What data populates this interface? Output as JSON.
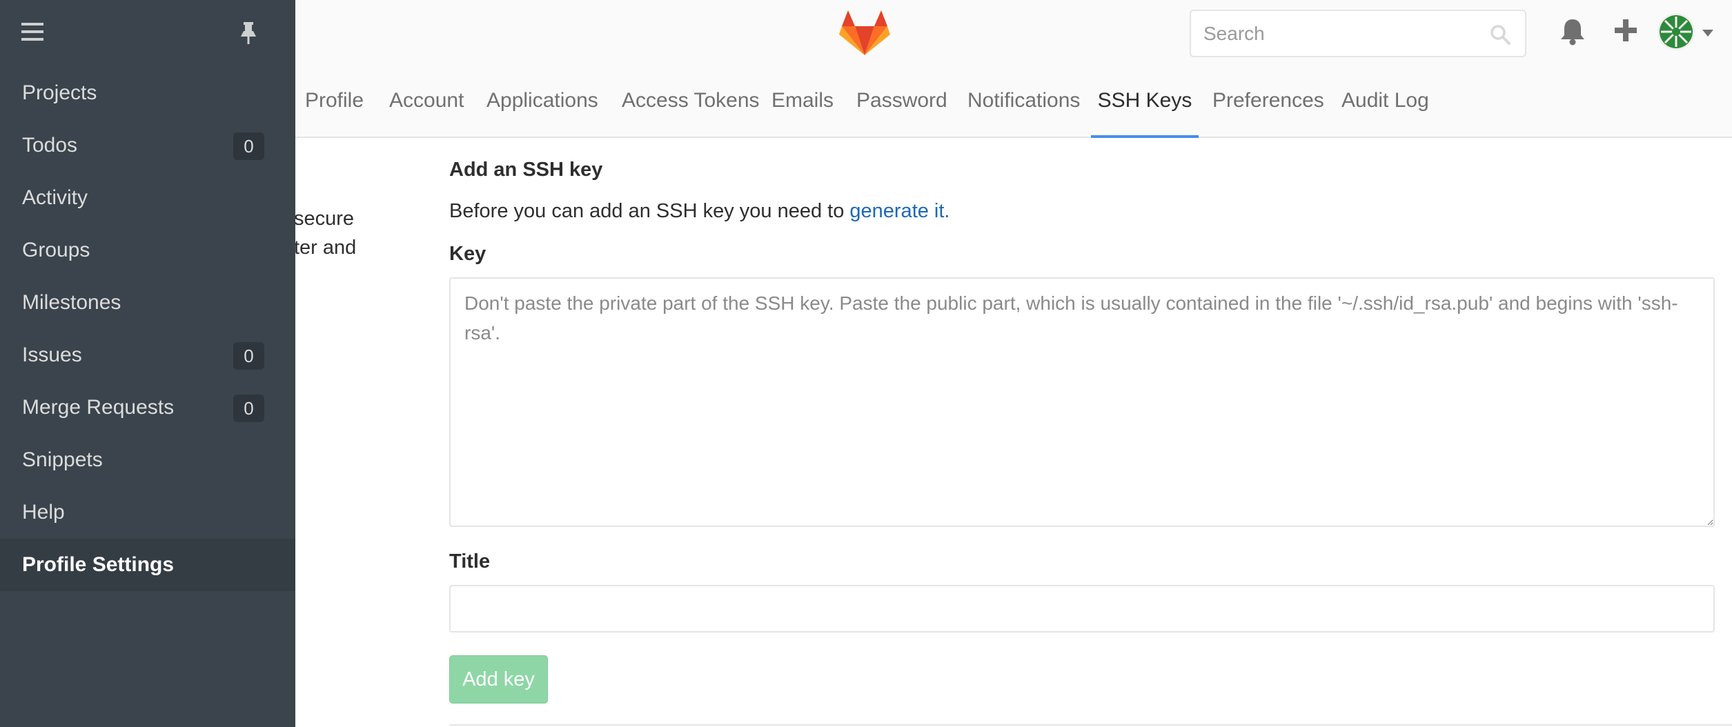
{
  "header": {
    "search_placeholder": "Search"
  },
  "nav_tabs": [
    {
      "label": "Profile"
    },
    {
      "label": "Account"
    },
    {
      "label": "Applications"
    },
    {
      "label": "Access Tokens"
    },
    {
      "label": "Emails"
    },
    {
      "label": "Password"
    },
    {
      "label": "Notifications"
    },
    {
      "label": "SSH Keys",
      "active": true
    },
    {
      "label": "Preferences"
    },
    {
      "label": "Audit Log"
    }
  ],
  "sidebar": {
    "items": [
      {
        "label": "Projects"
      },
      {
        "label": "Todos",
        "badge": "0"
      },
      {
        "label": "Activity"
      },
      {
        "label": "Groups"
      },
      {
        "label": "Milestones"
      },
      {
        "label": "Issues",
        "badge": "0"
      },
      {
        "label": "Merge Requests",
        "badge": "0"
      },
      {
        "label": "Snippets"
      },
      {
        "label": "Help"
      },
      {
        "label": "Profile Settings",
        "active": true
      }
    ]
  },
  "content": {
    "intro_fragment_line1": "secure",
    "intro_fragment_line2": "ter and",
    "section_title": "Add an SSH key",
    "lead_text": "Before you can add an SSH key you need to",
    "lead_link": "generate it.",
    "key_label": "Key",
    "key_placeholder": "Don't paste the private part of the SSH key. Paste the public part, which is usually contained in the file '~/.ssh/id_rsa.pub' and begins with 'ssh-rsa'.",
    "title_label": "Title",
    "title_value": "",
    "add_key_button": "Add key"
  },
  "colors": {
    "sidebar_bg": "#3b444c",
    "active_tab_underline": "#4a8bee",
    "link": "#1b69b6",
    "add_button_bg": "#8fd6a6",
    "logo_orange": "#fc6d26",
    "avatar_green": "#2d8a3a"
  },
  "icons": {
    "header": [
      "gitlab-logo",
      "search-icon",
      "bell-icon",
      "plus-icon",
      "avatar",
      "chevron-down-icon"
    ],
    "sidebar": [
      "hamburger-icon",
      "pin-icon"
    ]
  }
}
